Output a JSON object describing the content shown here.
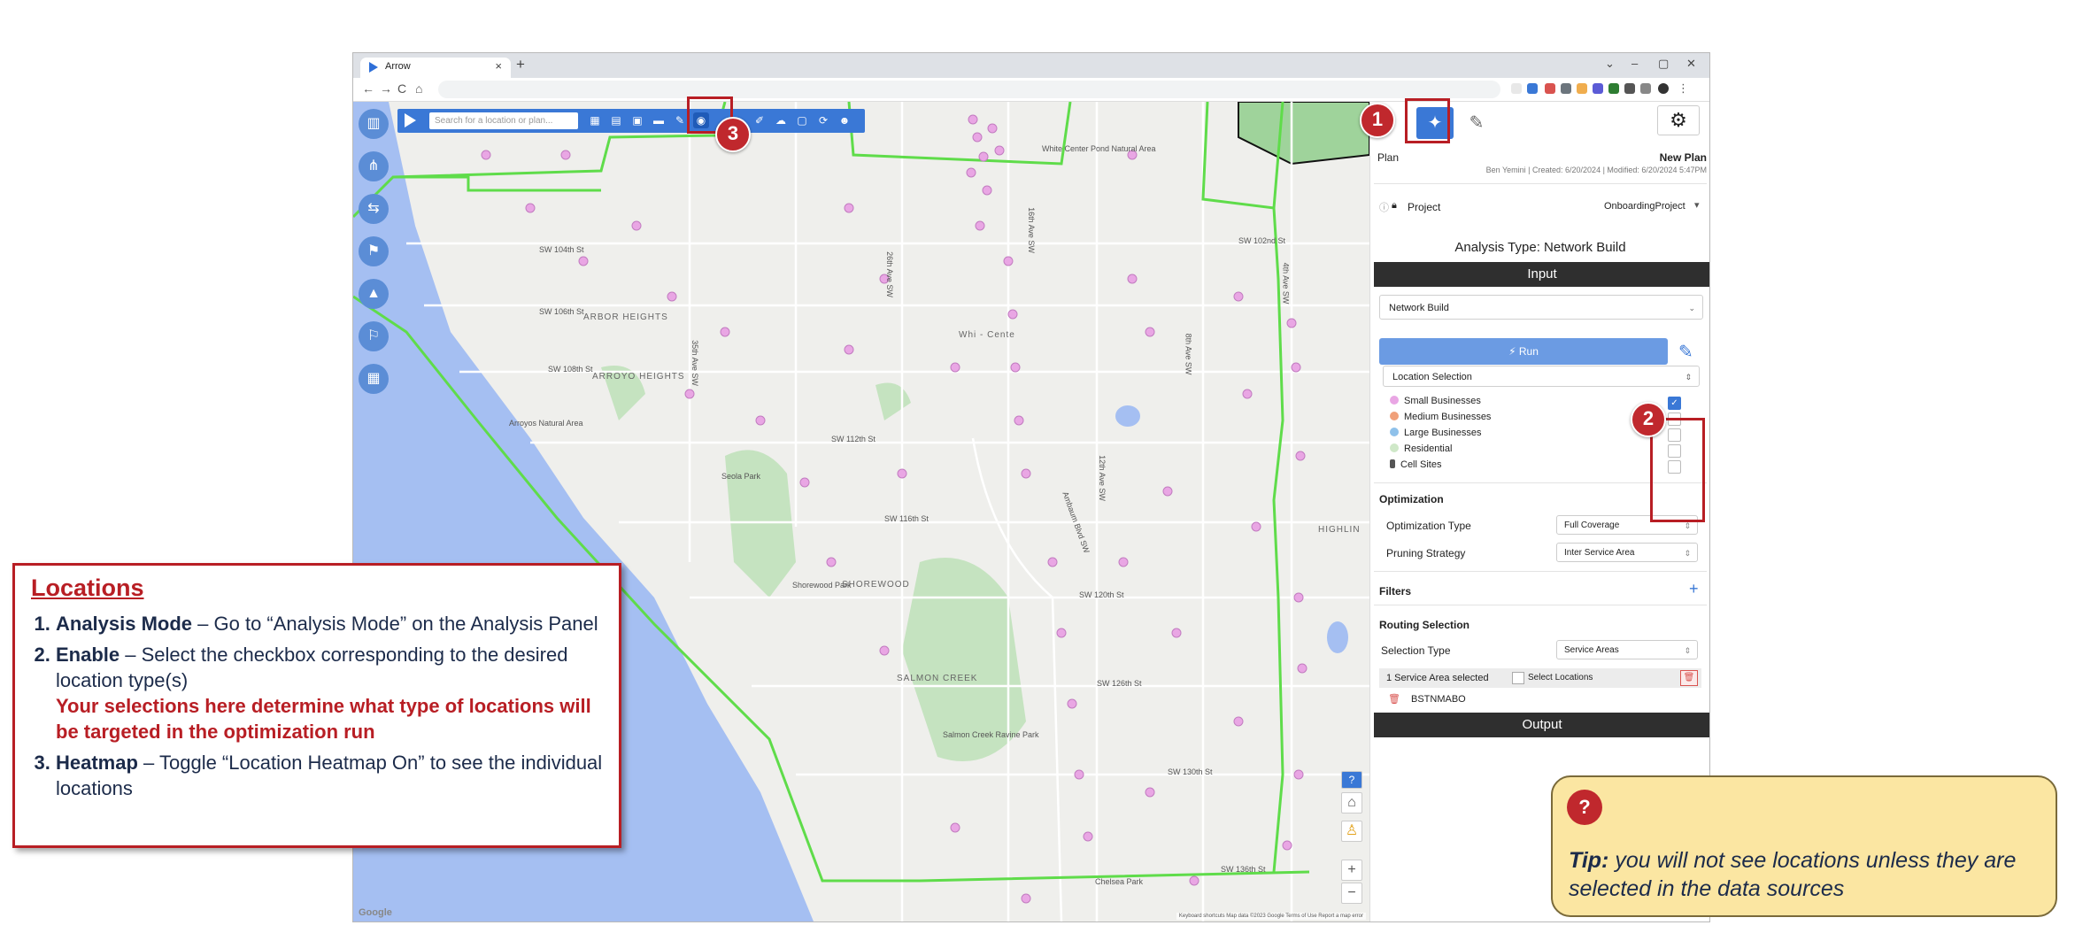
{
  "browser": {
    "tab_title": "Arrow",
    "tab_close": "×",
    "new_tab": "+",
    "win_controls": [
      "⌄",
      "–",
      "▢",
      "✕"
    ],
    "nav": [
      "←",
      "→",
      "C",
      "⌂"
    ]
  },
  "map": {
    "search_placeholder": "Search for a location or plan...",
    "place_labels": [
      "ARBOR HEIGHTS",
      "ARROYO HEIGHTS",
      "SHOREWOOD",
      "SALMON CREEK",
      "HIGHLIN",
      "Whi - Cente",
      "Seola Park",
      "Shorewood Park",
      "Salmon Creek Ravine Park",
      "Arroyos Natural Area",
      "White Center Pond Natural Area",
      "Chelsea Park"
    ],
    "street_labels": [
      "SW 104th St",
      "SW 106th St",
      "SW 108th St",
      "SW 112th St",
      "SW 116th St",
      "SW 120th St",
      "SW 126th St",
      "SW 130th St",
      "SW 136th St",
      "SW 102nd St",
      "26th Ave SW",
      "35th Ave SW",
      "16th Ave SW",
      "12th Ave SW",
      "8th Ave SW",
      "4th Ave SW",
      "Ambaum Blvd SW"
    ],
    "zoom_in": "+",
    "zoom_out": "−",
    "help": "?",
    "attribution": "Keyboard shortcuts  Map data ©2023 Google  Terms of Use  Report a map error",
    "google": "Google"
  },
  "panel": {
    "plan_label": "Plan",
    "plan_name": "New Plan",
    "plan_meta": "Ben Yemini | Created: 6/20/2024 | Modified: 6/20/2024 5:47PM",
    "project_label": "Project",
    "project_value": "OnboardingProject",
    "analysis_type": "Analysis Type: Network Build",
    "input_header": "Input",
    "analysis_select": "Network Build",
    "run_label": "⚡ Run",
    "location_selection": "Location Selection",
    "locations": [
      {
        "label": "Small Businesses",
        "color": "#e9a6e4",
        "checked": true
      },
      {
        "label": "Medium Businesses",
        "color": "#f0a07a",
        "checked": false
      },
      {
        "label": "Large Businesses",
        "color": "#8fc1ea",
        "checked": false
      },
      {
        "label": "Residential",
        "color": "#cfe8c8",
        "checked": false
      },
      {
        "label": "Cell Sites",
        "color": "#555555",
        "checked": false
      }
    ],
    "optimization_header": "Optimization",
    "optimization_type_label": "Optimization Type",
    "optimization_type_value": "Full Coverage",
    "pruning_label": "Pruning Strategy",
    "pruning_value": "Inter Service Area",
    "filters_header": "Filters",
    "filters_add": "+",
    "routing_header": "Routing Selection",
    "selection_type_label": "Selection Type",
    "selection_type_value": "Service Areas",
    "service_area_selected": "1 Service Area selected",
    "select_locations": "Select Locations",
    "service_area_code": "BSTNMABO",
    "output_header": "Output"
  },
  "callouts": {
    "badges": [
      "1",
      "2",
      "3"
    ]
  },
  "instructions": {
    "title": "Locations",
    "steps": [
      {
        "bold": "Analysis Mode",
        "text": " – Go to “Analysis Mode” on the Analysis Panel",
        "warning": ""
      },
      {
        "bold": "Enable",
        "text": " – Select the checkbox corresponding to the desired location type(s)",
        "warning": "Your selections here determine what type of locations will be targeted in the optimization run"
      },
      {
        "bold": "Heatmap",
        "text": " – Toggle “Location Heatmap On” to see the individual locations",
        "warning": ""
      }
    ]
  },
  "tip": {
    "icon": "?",
    "bold": "Tip:",
    "text": " you will not see locations unless they are selected in the data sources"
  },
  "colors": {
    "accent_blue": "#3a78d6",
    "callout_red": "#b81e24",
    "service_area_green": "#5fdc4a",
    "water": "#a5bff2",
    "tip_yellow": "#fbe6a2"
  }
}
